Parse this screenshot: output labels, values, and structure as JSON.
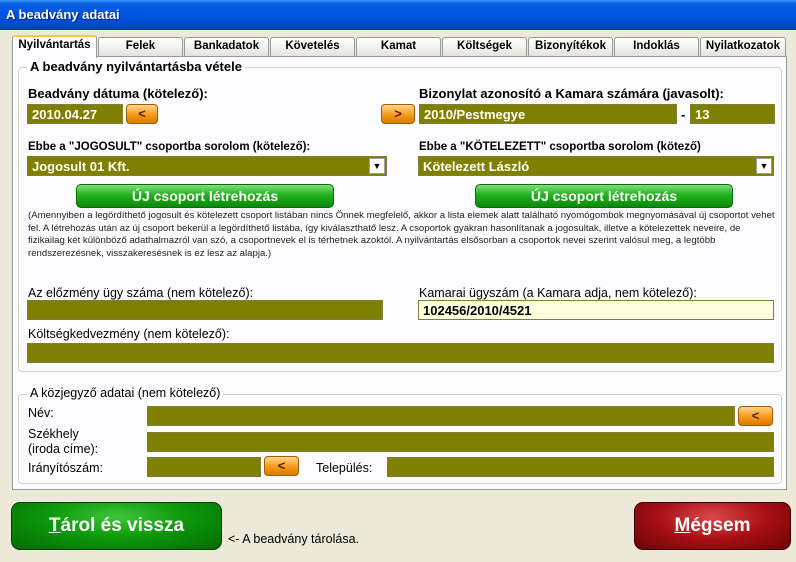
{
  "window": {
    "title": "A beadvány adatai"
  },
  "tabs": [
    {
      "label": "Nyilvántartás",
      "active": true
    },
    {
      "label": "Felek"
    },
    {
      "label": "Bankadatok"
    },
    {
      "label": "Követelés"
    },
    {
      "label": "Kamat"
    },
    {
      "label": "Költségek"
    },
    {
      "label": "Bizonyítékok"
    },
    {
      "label": "Indoklás"
    },
    {
      "label": "Nyilatkozatok"
    }
  ],
  "registration": {
    "group_title": "A beadvány nyilvántartásba vétele",
    "date_label": "Beadvány dátuma (kötelező):",
    "date_value": "2010.04.27",
    "date_btn": "<",
    "doc_id_label": "Bizonylat azonosító a Kamara számára (javasolt):",
    "doc_id_btn": ">",
    "doc_id_value": "2010/Pestmegye",
    "doc_id_sep": "-",
    "doc_id_suffix": "13",
    "jogosult_label": "Ebbe a \"JOGOSULT\" csoportba sorolom (kötelező):",
    "jogosult_value": "Jogosult 01 Kft.",
    "kotelezett_label": "Ebbe a \"KÖTELEZETT\" csoportba sorolom (kötező)",
    "kotelezett_value": "Kötelezett László",
    "new_group_btn_left": "ÚJ csoport létrehozás",
    "new_group_btn_right": "ÚJ csoport létrehozás",
    "info_text": "(Amennyiben a legördíthető jogosult és kötelezett csoport listában nincs Önnek megfelelő, akkor a lista elemek alatt található nyomógombok megnyomásával új csoportot vehet fel. A létrehozás után az új csoport bekerül a legördíthető listába, így kiválaszthatő lesz. A csoportok gyakran hasonlítanak a jogosultak, illetve a kötelezettek neveire, de fizikailag két különböző adathalmazról van szó, a csoportnevek el is térhetnek azoktól. A nyilvántartás elsősorban a csoportok nevei szerint valósul meg, a legtöbb rendszerezésnek, visszakeresésnek is ez lesz az alapja.)",
    "prev_case_label": "Az előzmény ügy száma (nem kötelező):",
    "prev_case_value": "",
    "chamber_label": "Kamarai ügyszám (a Kamara adja, nem kötelező):",
    "chamber_value": "102456/2010/4521",
    "discount_label": "Költségkedvezmény (nem kötelező):",
    "discount_value": ""
  },
  "notary": {
    "group_title": "A közjegyző adatai (nem kötelező)",
    "name_label": "Név:",
    "name_value": "",
    "name_btn": "<",
    "seat_label_1": "Székhely",
    "seat_label_2": "(iroda címe):",
    "seat_value": "",
    "zip_label": "Irányítószám:",
    "zip_value": "",
    "zip_btn": "<",
    "city_label": "Település:",
    "city_value": ""
  },
  "footer": {
    "save_btn_first": "T",
    "save_btn_rest": "árol és vissza",
    "save_hint": "<- A beadvány tárolása.",
    "cancel_btn_first": "M",
    "cancel_btn_rest": "égsem"
  }
}
